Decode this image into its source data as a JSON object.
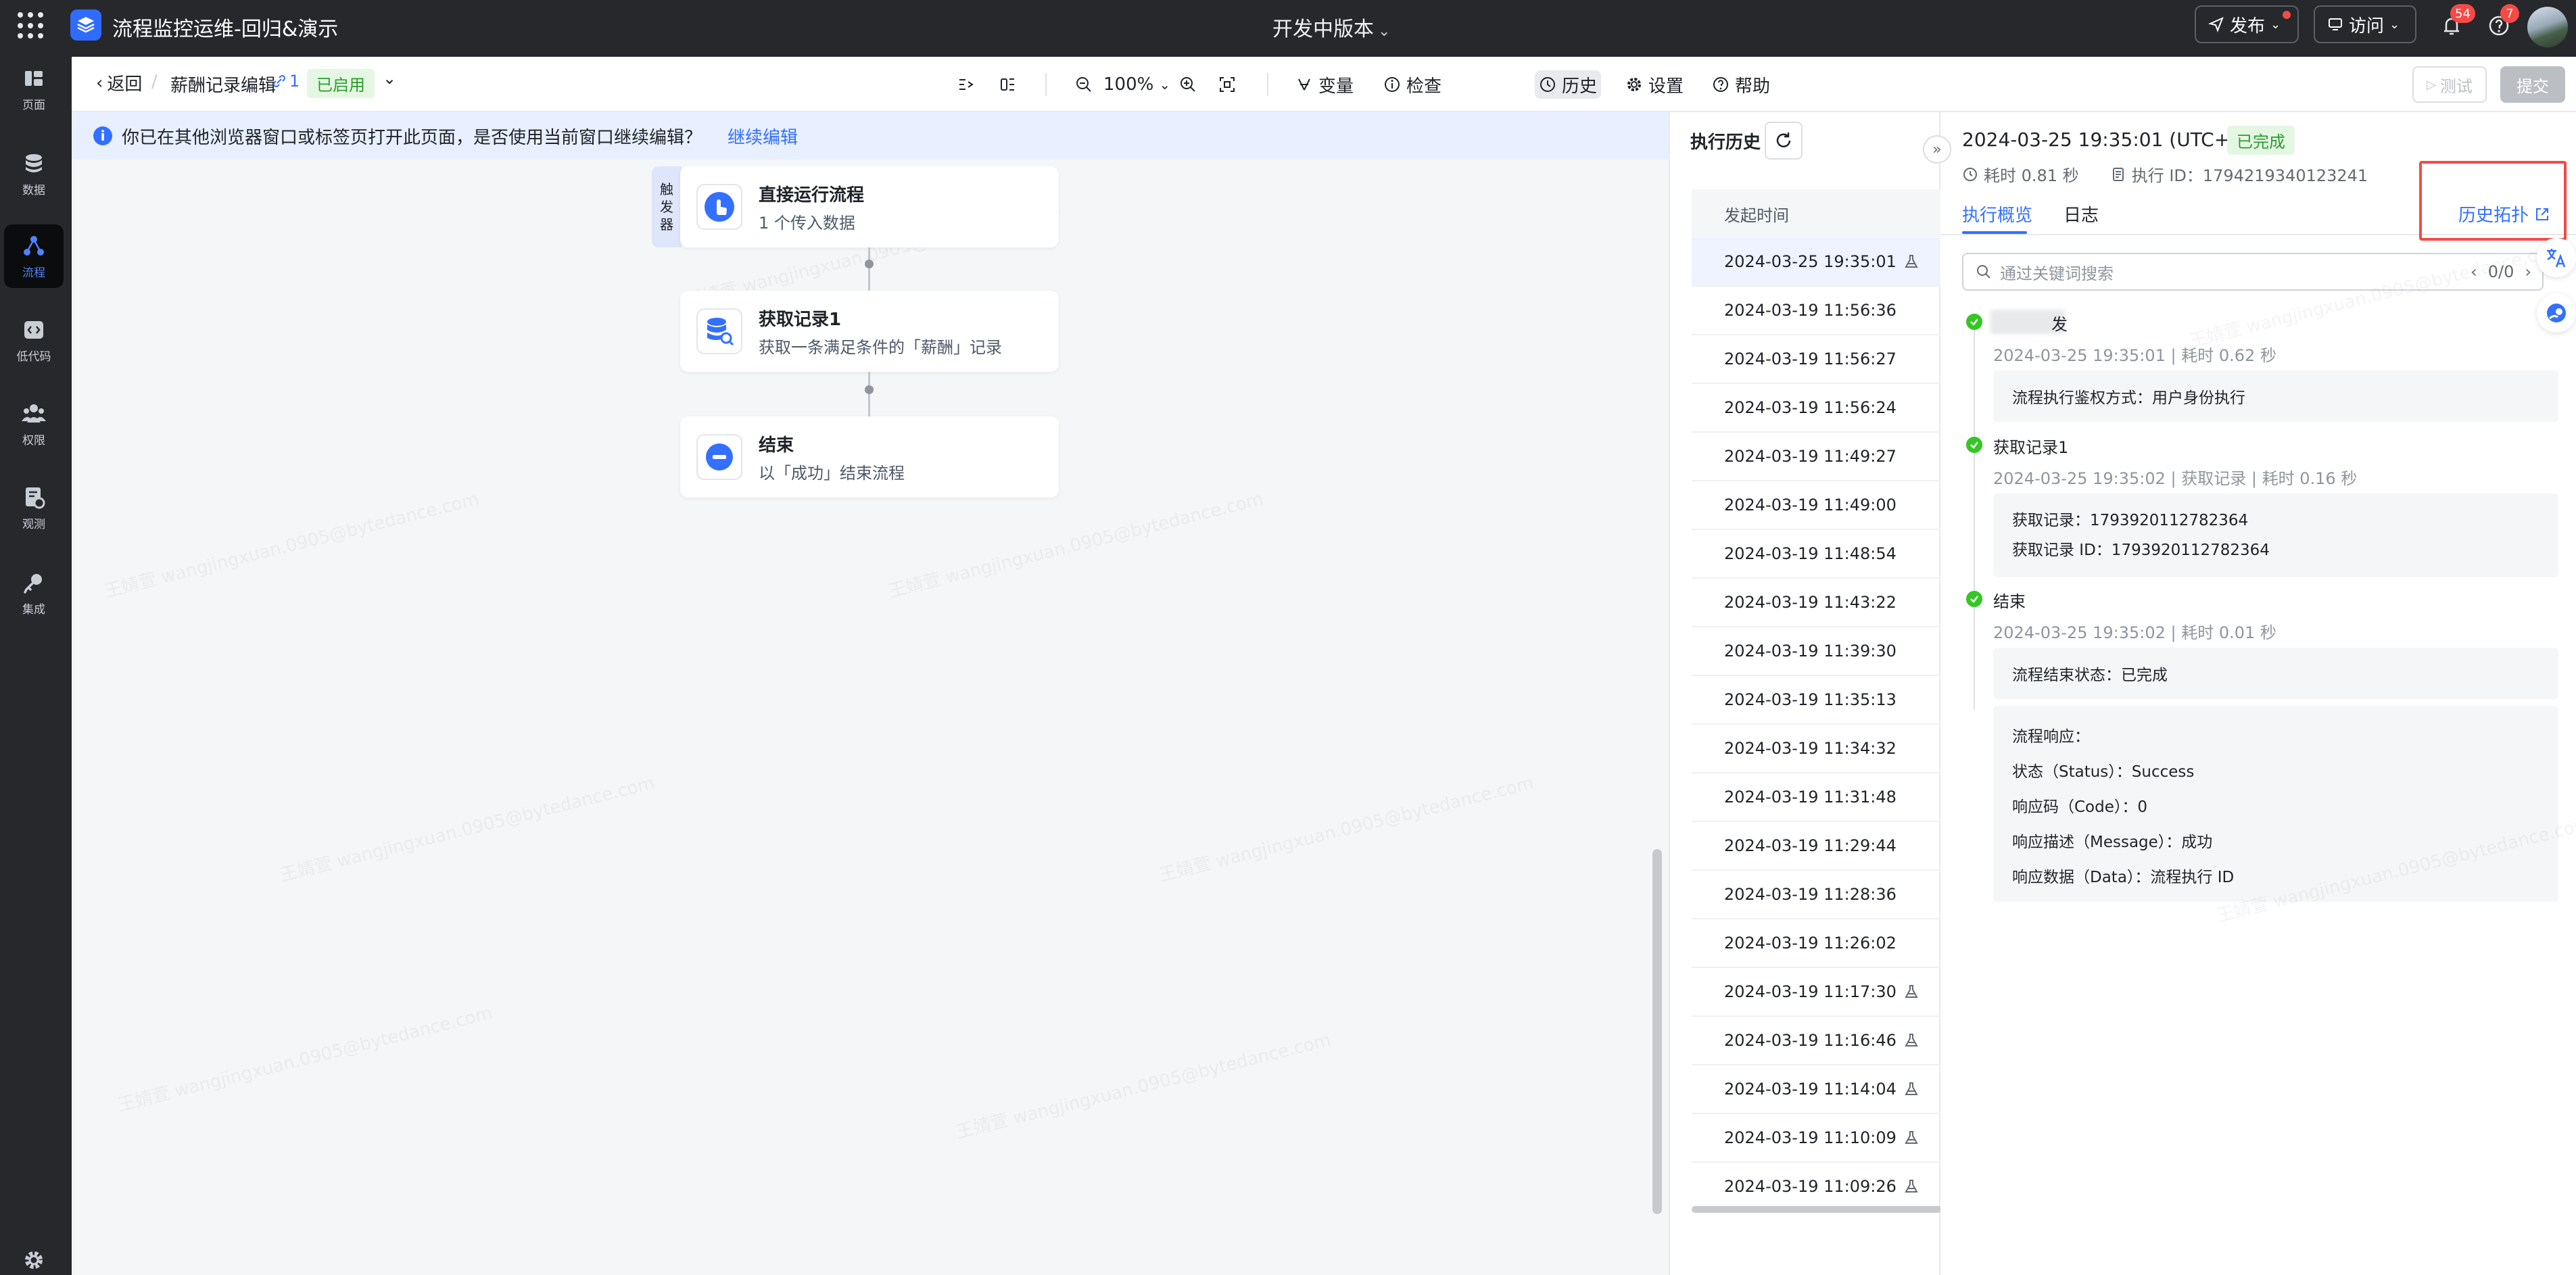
{
  "topbar": {
    "app_title": "流程监控运维-回归&演示",
    "center_title": "开发中版本",
    "publish_label": "发布",
    "visit_label": "访问",
    "notification_count": "54",
    "help_count": "7"
  },
  "rail": {
    "items": [
      {
        "label": "页面",
        "icon": "page-icon"
      },
      {
        "label": "数据",
        "icon": "database-icon"
      },
      {
        "label": "流程",
        "icon": "flow-icon"
      },
      {
        "label": "低代码",
        "icon": "code-icon"
      },
      {
        "label": "权限",
        "icon": "users-icon"
      },
      {
        "label": "观测",
        "icon": "monitor-icon"
      },
      {
        "label": "集成",
        "icon": "plug-icon"
      }
    ]
  },
  "toolbar": {
    "back_label": "返回",
    "flow_name": "薪酬记录编辑",
    "version": "1",
    "status": "已启用",
    "zoom": "100%",
    "variables": "变量",
    "check": "检查",
    "history": "历史",
    "settings": "设置",
    "help": "帮助",
    "test": "测试",
    "submit": "提交"
  },
  "banner": {
    "message": "你已在其他浏览器窗口或标签页打开此页面，是否使用当前窗口继续编辑？",
    "link": "继续编辑"
  },
  "canvas": {
    "trigger_tag": [
      "触",
      "发",
      "器"
    ],
    "nodes": [
      {
        "title": "直接运行流程",
        "desc": "1 个传入数据"
      },
      {
        "title": "获取记录1",
        "desc": "获取一条满足条件的「薪酬」记录"
      },
      {
        "title": "结束",
        "desc": "以「成功」结束流程"
      }
    ],
    "watermark": "王婧萱 wangjingxuan.0905@bytedance.com"
  },
  "history": {
    "title": "执行历史",
    "column": "发起时间",
    "rows": [
      {
        "time": "2024-03-25 19:35:01",
        "test": true
      },
      {
        "time": "2024-03-19 11:56:36",
        "test": false
      },
      {
        "time": "2024-03-19 11:56:27",
        "test": false
      },
      {
        "time": "2024-03-19 11:56:24",
        "test": false
      },
      {
        "time": "2024-03-19 11:49:27",
        "test": false
      },
      {
        "time": "2024-03-19 11:49:00",
        "test": false
      },
      {
        "time": "2024-03-19 11:48:54",
        "test": false
      },
      {
        "time": "2024-03-19 11:43:22",
        "test": false
      },
      {
        "time": "2024-03-19 11:39:30",
        "test": false
      },
      {
        "time": "2024-03-19 11:35:13",
        "test": false
      },
      {
        "time": "2024-03-19 11:34:32",
        "test": false
      },
      {
        "time": "2024-03-19 11:31:48",
        "test": false
      },
      {
        "time": "2024-03-19 11:29:44",
        "test": false
      },
      {
        "time": "2024-03-19 11:28:36",
        "test": false
      },
      {
        "time": "2024-03-19 11:26:02",
        "test": false
      },
      {
        "time": "2024-03-19 11:17:30",
        "test": true
      },
      {
        "time": "2024-03-19 11:16:46",
        "test": true
      },
      {
        "time": "2024-03-19 11:14:04",
        "test": true
      },
      {
        "time": "2024-03-19 11:10:09",
        "test": true
      },
      {
        "time": "2024-03-19 11:09:26",
        "test": true
      }
    ]
  },
  "detail": {
    "title": "2024-03-25 19:35:01 (UTC+8)",
    "status": "已完成",
    "duration": "耗时 0.81 秒",
    "exec_id": "执行 ID：1794219340123241",
    "tab_overview": "执行概览",
    "tab_log": "日志",
    "topo_link": "历史拓扑",
    "search_placeholder": "通过关键词搜索",
    "search_count": "0/0",
    "steps": [
      {
        "title": "发",
        "sub": "2024-03-25 19:35:01 | 耗时 0.62 秒",
        "lines": [
          "流程执行鉴权方式：用户身份执行"
        ]
      },
      {
        "title": "获取记录1",
        "sub": "2024-03-25 19:35:02 | 获取记录 | 耗时 0.16 秒",
        "lines": [
          "获取记录：1793920112782364",
          "获取记录 ID：1793920112782364"
        ]
      },
      {
        "title": "结束",
        "sub": "2024-03-25 19:35:02 | 耗时 0.01 秒",
        "lines": [
          "流程结束状态：已完成"
        ]
      }
    ],
    "response": {
      "title": "流程响应：",
      "lines": [
        "状态（Status）：Success",
        "响应码（Code）：0",
        "响应描述（Message）：成功",
        "响应数据（Data）：流程执行 ID"
      ]
    }
  }
}
